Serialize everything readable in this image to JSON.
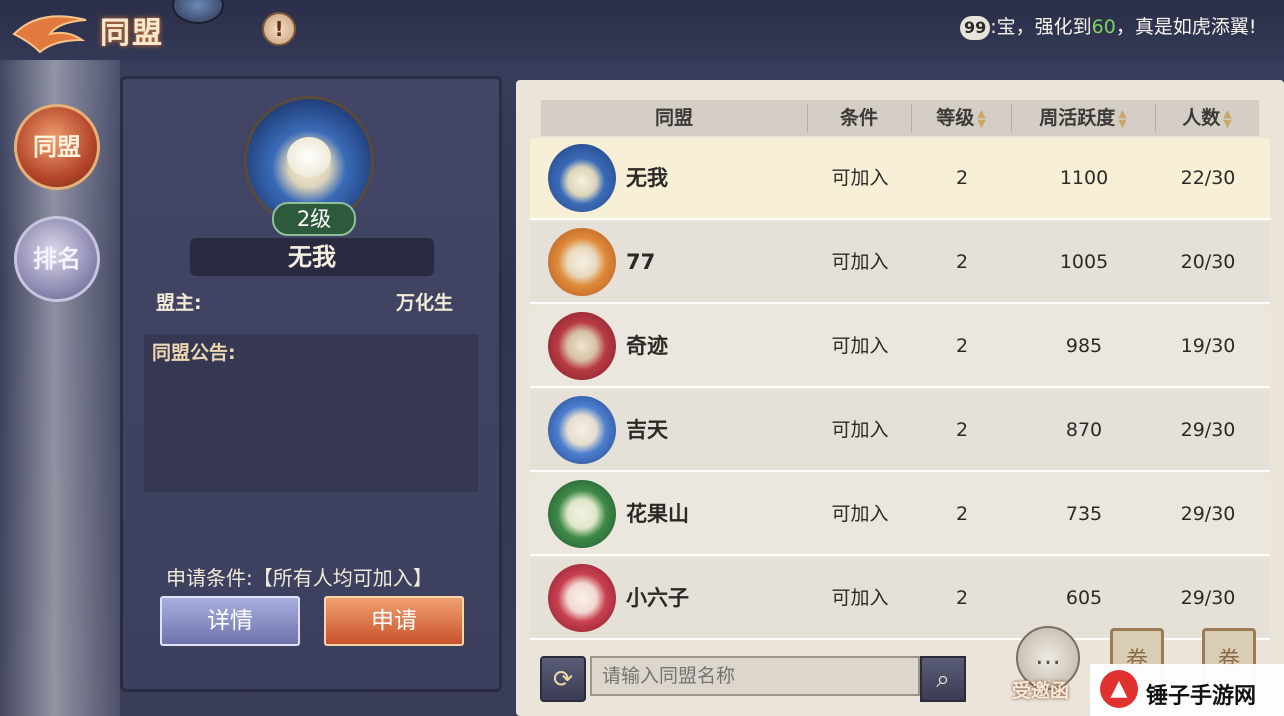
{
  "header": {
    "title": "同盟",
    "info_icon": "!",
    "notice_badge": "99",
    "notice_text_pre": ":宝，强化到",
    "notice_highlight": "60",
    "notice_text_post": "，真是如虎添翼!"
  },
  "sidebar": {
    "items": [
      {
        "label": "同盟",
        "active": true
      },
      {
        "label": "排名",
        "active": false
      }
    ]
  },
  "detail": {
    "level_badge": "2级",
    "name": "无我",
    "leader_label": "盟主:",
    "leader_value": "万化生",
    "announcement_label": "同盟公告:",
    "condition_text": "申请条件:【所有人均可加入】",
    "detail_button": "详情",
    "apply_button": "申请"
  },
  "table": {
    "columns": [
      {
        "label": "同盟",
        "sortable": false
      },
      {
        "label": "条件",
        "sortable": false
      },
      {
        "label": "等级",
        "sortable": true
      },
      {
        "label": "周活跃度",
        "sortable": true
      },
      {
        "label": "人数",
        "sortable": true
      }
    ],
    "rows": [
      {
        "name": "无我",
        "condition": "可加入",
        "level": "2",
        "activity": "1100",
        "members": "22/30",
        "emblem": "lotus-blue",
        "selected": true
      },
      {
        "name": "77",
        "condition": "可加入",
        "level": "2",
        "activity": "1005",
        "members": "20/30",
        "emblem": "tiger-orange",
        "selected": false
      },
      {
        "name": "奇迹",
        "condition": "可加入",
        "level": "2",
        "activity": "985",
        "members": "19/30",
        "emblem": "spider-red",
        "selected": false
      },
      {
        "name": "吉天",
        "condition": "可加入",
        "level": "2",
        "activity": "870",
        "members": "29/30",
        "emblem": "tiger-blue",
        "selected": false
      },
      {
        "name": "花果山",
        "condition": "可加入",
        "level": "2",
        "activity": "735",
        "members": "29/30",
        "emblem": "fox-green",
        "selected": false
      },
      {
        "name": "小六子",
        "condition": "可加入",
        "level": "2",
        "activity": "605",
        "members": "29/30",
        "emblem": "fox-red",
        "selected": false
      }
    ]
  },
  "search": {
    "placeholder": "请输入同盟名称"
  },
  "bottom_actions": {
    "invite_label": "受邀函"
  },
  "watermark": {
    "text": "锤子手游网"
  },
  "colors": {
    "accent_orange": "#c9522c",
    "accent_blue": "#6d73aa",
    "selected_row": "#f7f0d6",
    "highlight_green": "#7cd35c"
  }
}
